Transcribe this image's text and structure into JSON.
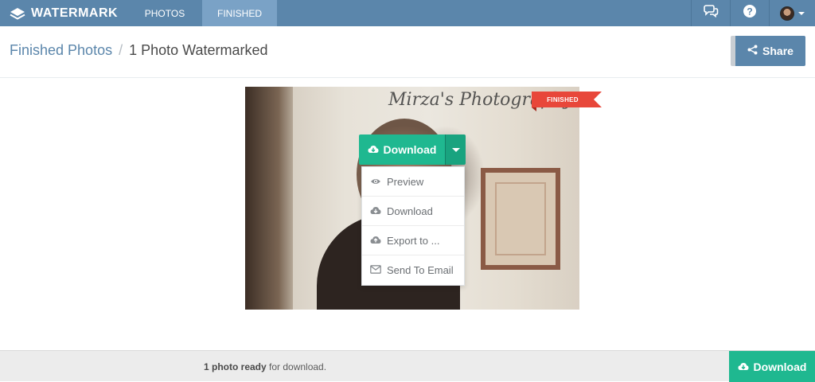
{
  "app": {
    "brand": "WATERMARK",
    "brand_icon": "layers-logo-icon"
  },
  "nav": {
    "tabs": [
      {
        "label": "PHOTOS",
        "active": false
      },
      {
        "label": "FINISHED",
        "active": true
      }
    ],
    "icons": [
      "chat-icon",
      "help-icon",
      "avatar"
    ]
  },
  "breadcrumb": {
    "root": "Finished Photos",
    "separator": "/",
    "current": "1 Photo Watermarked"
  },
  "share": {
    "label": "Share",
    "icon": "share-icon"
  },
  "photo": {
    "watermark_text": "Mirza's Photography",
    "ribbon": "FINISHED"
  },
  "download_menu": {
    "button_label": "Download",
    "items": [
      {
        "label": "Preview",
        "icon": "eye-icon"
      },
      {
        "label": "Download",
        "icon": "cloud-download-icon"
      },
      {
        "label": "Export to ...",
        "icon": "cloud-upload-icon"
      },
      {
        "label": "Send To Email",
        "icon": "envelope-icon"
      }
    ]
  },
  "footer": {
    "count_text": "1 photo ready",
    "suffix_text": " for download.",
    "download_label": "Download"
  },
  "colors": {
    "nav": "#5b86ab",
    "active_tab": "#7aa2c6",
    "accent_green": "#1fb890",
    "ribbon_red": "#e8473a"
  }
}
